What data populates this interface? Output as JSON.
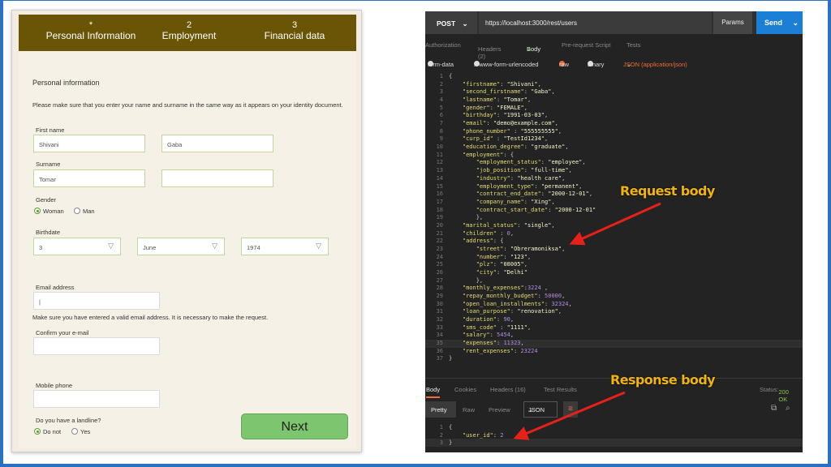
{
  "form": {
    "steps": [
      {
        "num": "*",
        "label": "Personal Information"
      },
      {
        "num": "2",
        "label": "Employment"
      },
      {
        "num": "3",
        "label": "Financial data"
      }
    ],
    "section_title": "Personal information",
    "intro": "Please make sure that you enter your name and surname in the same way as it appears on your identity document.",
    "first_name_label": "First name",
    "first_name": "Shivani",
    "second_name": "Gaba",
    "surname_label": "Surname",
    "surname": "Tomar",
    "second_surname": "",
    "gender_label": "Gender",
    "gender_options": [
      "Woman",
      "Man"
    ],
    "birthdate_label": "Birthdate",
    "birth_day": "3",
    "birth_month": "June",
    "birth_year": "1974",
    "email_label": "Email address",
    "email_value": "|",
    "email_note": "Make sure you have entered a valid email address. It is necessary to make the request.",
    "confirm_email_label": "Confirm your e-mail",
    "mobile_label": "Mobile phone",
    "landline_label": "Do you have a landline?",
    "landline_options": [
      "Do not",
      "Yes"
    ],
    "next_label": "Next"
  },
  "postman": {
    "method": "POST",
    "url": "https://localhost:3000/rest/users",
    "params_label": "Params",
    "send_label": "Send",
    "tabs": [
      "Authorization",
      "Headers (2)",
      "Body",
      "Pre-request Script",
      "Tests"
    ],
    "body_modes": [
      "form-data",
      "x-www-form-urlencoded",
      "raw",
      "binary"
    ],
    "content_type": "JSON (application/json)",
    "request_lines": [
      "{",
      "    \"firstname\": \"Shivani\",",
      "    \"second_firstname\": \"Gaba\",",
      "    \"lastname\": \"Tomar\",",
      "    \"gender\": \"FEMALE\",",
      "    \"birthday\": \"1991-03-03\",",
      "    \"email\": \"demo@example.com\",",
      "    \"phone_number\" : \"555555555\",",
      "    \"curp_id\" : \"TestId1234\",",
      "    \"education_degree\": \"graduate\",",
      "    \"employment\": {",
      "        \"employment_status\": \"employee\",",
      "        \"job_position\": \"full-time\",",
      "        \"industry\": \"health care\",",
      "        \"employment_type\": \"permanent\",",
      "        \"contract_end_date\": \"2000-12-01\",",
      "        \"company_name\": \"Xing\",",
      "        \"contract_start_date\": \"2000-12-01\"",
      "        },",
      "    \"marital_status\": \"single\",",
      "    \"children\" : 0,",
      "    \"address\": {",
      "        \"street\": \"Obreramoniksa\",",
      "        \"number\": \"123\",",
      "        \"plz\": \"08005\",",
      "        \"city\": \"Delhi\"",
      "        },",
      "    \"monthly_expenses\":3224 ,",
      "    \"repay_monthly_budget\": 50000,",
      "    \"open_loan_installments\": 32324,",
      "    \"loan_purpose\": \"renovation\",",
      "    \"duration\": 90,",
      "    \"sms_code\" : \"1111\",",
      "    \"salary\": 5454,",
      "    \"expenses\": 11323,",
      "    \"rent_expenses\": 23224",
      "}"
    ],
    "response_tabs": [
      "Body",
      "Cookies",
      "Headers (16)",
      "Test Results"
    ],
    "status": "Status: 200 OK",
    "view_modes": [
      "Pretty",
      "Raw",
      "Preview"
    ],
    "format": "JSON",
    "response_lines": [
      "{",
      "    \"user_id\": 2",
      "}"
    ]
  },
  "annotations": {
    "request": "Request body",
    "response": "Response body"
  },
  "colors": {
    "brand_bar": "#6a5406",
    "next_button": "#7dc56e",
    "send_button": "#1b7fd6",
    "annotation": "#f0b40a",
    "arrow": "#e8201a"
  }
}
